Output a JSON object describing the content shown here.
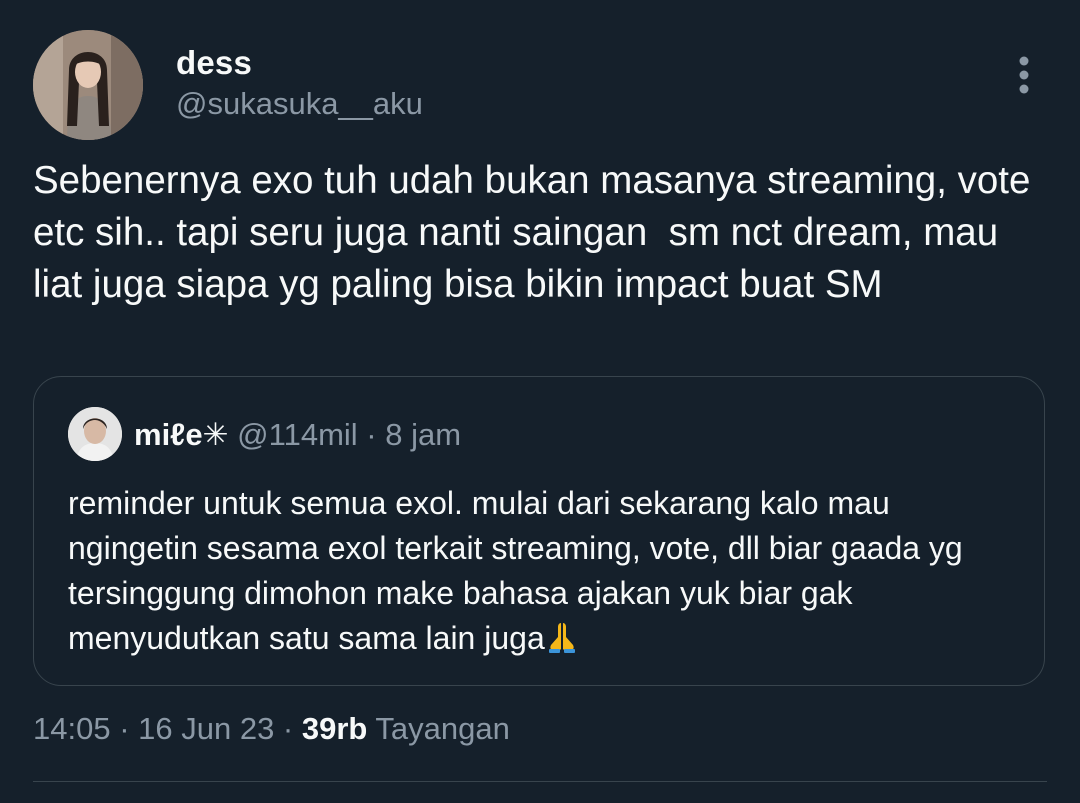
{
  "author": {
    "display_name": "dess",
    "handle": "@sukasuka__aku"
  },
  "tweet": {
    "text": "Sebenernya exo tuh udah bukan masanya streaming, vote etc sih.. tapi seru juga nanti saingan  sm nct dream, mau liat juga siapa yg paling bisa bikin impact buat SM"
  },
  "quote": {
    "display_name": "miℓe✳",
    "handle": "@114mil",
    "separator": " · ",
    "time": "8 jam",
    "text": "reminder untuk semua exol. mulai dari sekarang kalo mau ngingetin sesama exol terkait streaming, vote, dll biar gaada yg tersinggung dimohon make bahasa ajakan yuk biar gak menyudutkan satu sama lain juga",
    "emoji": "folded-hands"
  },
  "meta": {
    "time": "14:05",
    "sep1": " · ",
    "date": "16 Jun 23",
    "sep2": " · ",
    "views_count": "39rb",
    "views_label": " Tayangan"
  },
  "icons": {
    "more": "more-vertical-icon"
  },
  "colors": {
    "background": "#15202b",
    "text_primary": "#f7f9f9",
    "text_secondary": "#8b98a5",
    "border": "#38444d"
  }
}
